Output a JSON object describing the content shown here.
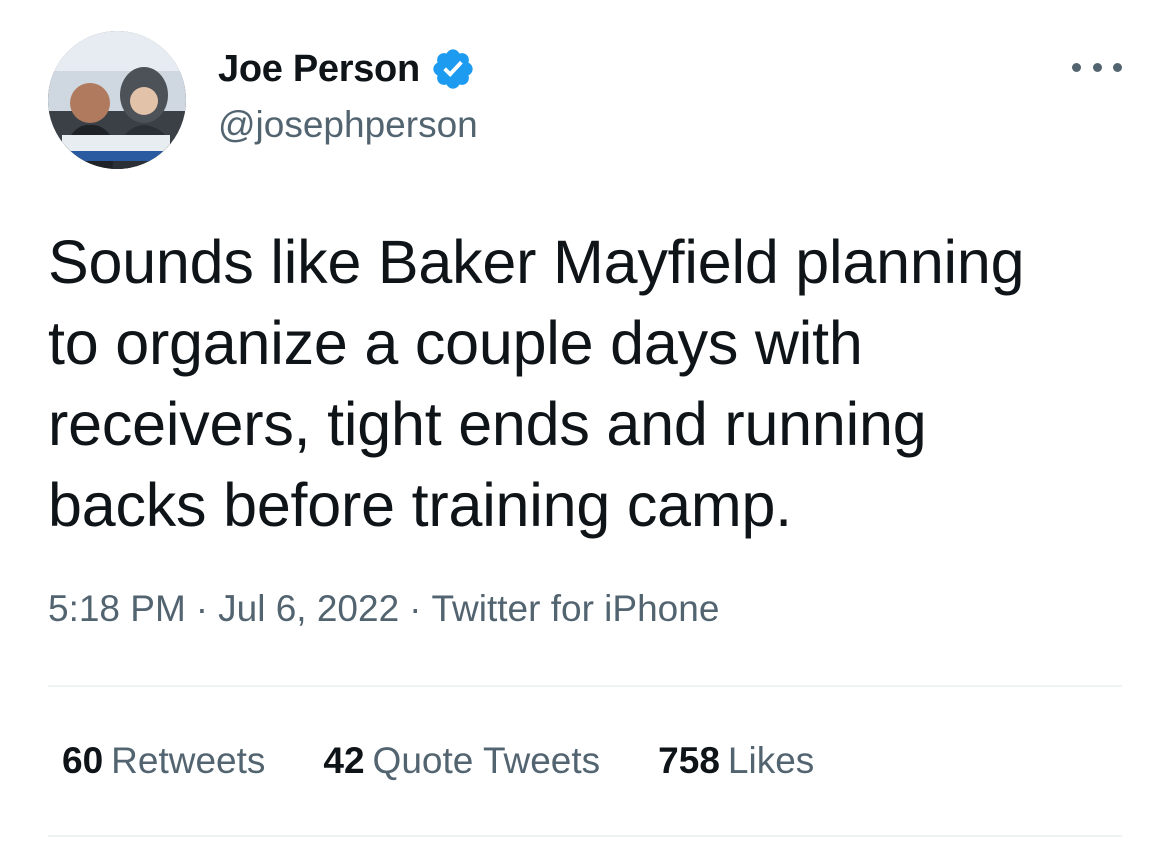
{
  "author": {
    "display_name": "Joe Person",
    "handle": "@josephperson",
    "verified": true,
    "avatar_icon": "profile-photo"
  },
  "tweet": {
    "text_lines": [
      "Sounds like Baker Mayfield planning",
      "to organize a couple days with",
      "receivers, tight ends and running",
      "backs before training camp."
    ],
    "time": "5:18 PM",
    "date": "Jul 6, 2022",
    "source": "Twitter for iPhone",
    "separator": "·"
  },
  "stats": {
    "retweets": {
      "count": "60",
      "label": "Retweets"
    },
    "quote_tweets": {
      "count": "42",
      "label": "Quote Tweets"
    },
    "likes": {
      "count": "758",
      "label": "Likes"
    }
  },
  "colors": {
    "verified_blue": "#1d9bf0",
    "text_primary": "#0f1419",
    "text_secondary": "#536471",
    "divider": "#eff3f4"
  },
  "icons": {
    "more": "more-horizontal-icon",
    "verified": "verified-badge-icon"
  }
}
